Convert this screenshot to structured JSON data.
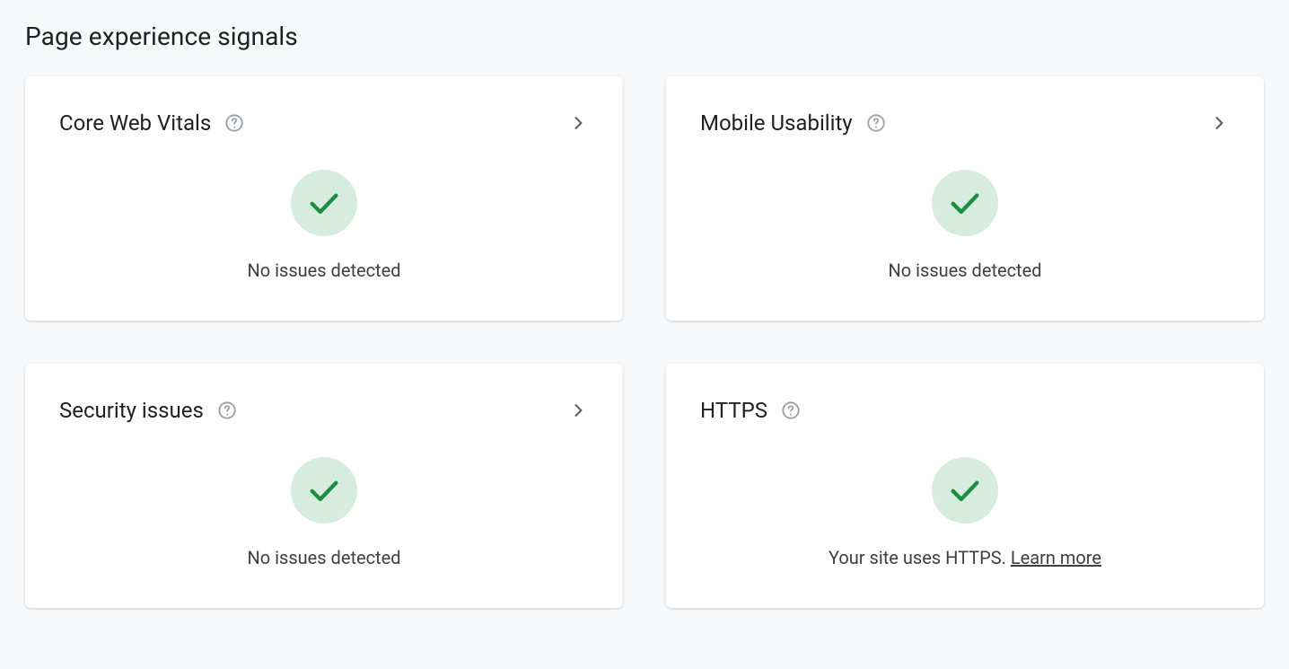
{
  "section": {
    "title": "Page experience signals"
  },
  "cards": {
    "core_web_vitals": {
      "title": "Core Web Vitals",
      "status": "No issues detected"
    },
    "mobile_usability": {
      "title": "Mobile Usability",
      "status": "No issues detected"
    },
    "security_issues": {
      "title": "Security issues",
      "status": "No issues detected"
    },
    "https": {
      "title": "HTTPS",
      "status_prefix": "Your site uses HTTPS. ",
      "learn_more_label": "Learn more"
    }
  }
}
